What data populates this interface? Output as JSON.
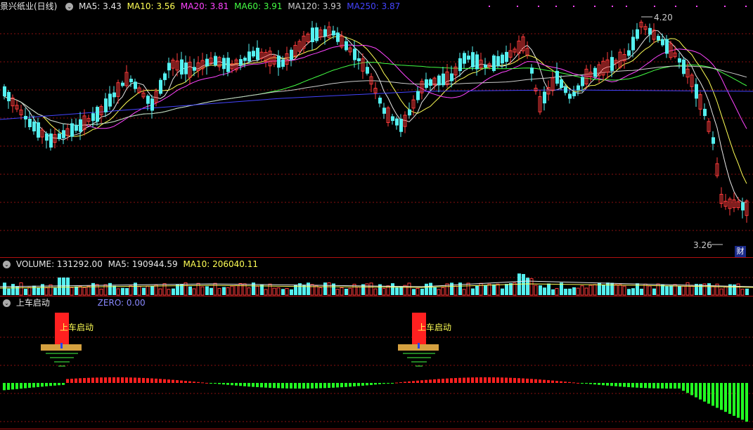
{
  "price_panel": {
    "stock_title": "景兴纸业(日线)",
    "ma_items": [
      {
        "label": "MA5: 3.43",
        "color": "#e8e8e8"
      },
      {
        "label": "MA10: 3.56",
        "color": "#ffff55"
      },
      {
        "label": "MA20: 3.81",
        "color": "#ff44ff"
      },
      {
        "label": "MA60: 3.91",
        "color": "#44ff44"
      },
      {
        "label": "MA120: 3.93",
        "color": "#cccccc"
      },
      {
        "label": "MA250: 3.87",
        "color": "#4444ff"
      }
    ],
    "high_marker": "4.20",
    "low_marker": "3.26",
    "badge": "财"
  },
  "volume_panel": {
    "title": "VOLUME: 131292.00",
    "ma5": "MA5: 190944.59",
    "ma10": "MA10: 206040.11"
  },
  "indicator_panel": {
    "title": "上车启动",
    "zero": "ZERO: 0.00",
    "signal_label": "上车启动"
  },
  "colors": {
    "up": "#ff3b3b",
    "down": "#54f0f0",
    "macd_pos": "#ff2020",
    "macd_neg": "#22ff22",
    "grid": "#8a1010"
  }
}
